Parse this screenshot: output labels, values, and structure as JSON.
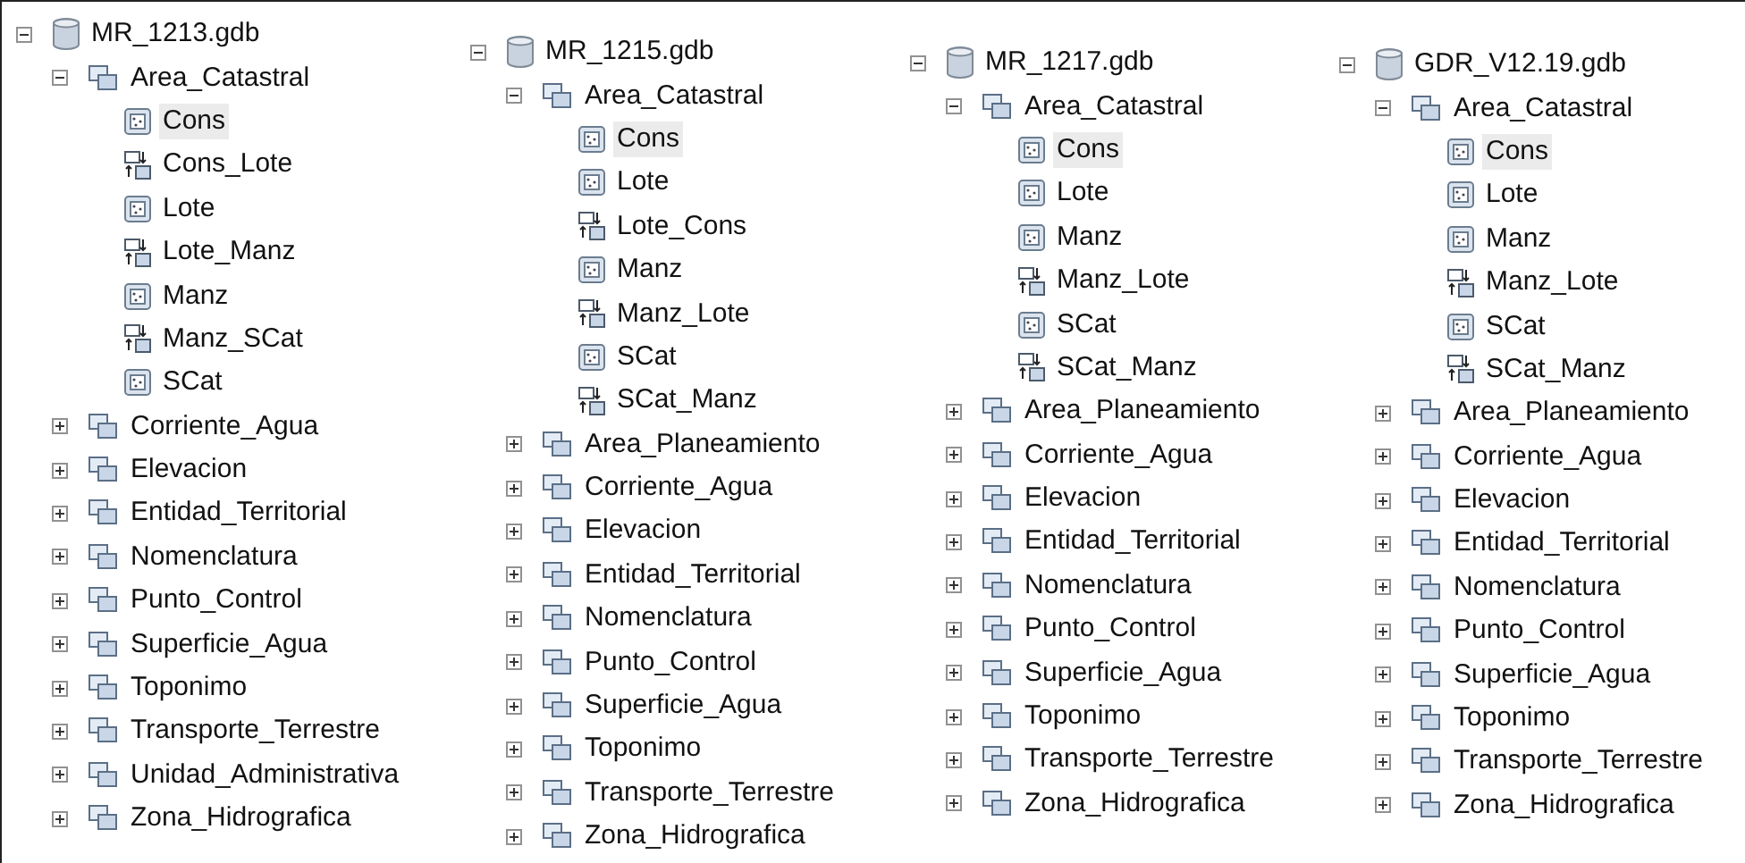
{
  "trees": [
    {
      "label": "MR_1213.gdb",
      "kind": "geodatabase",
      "expanded": true,
      "selected": false,
      "children": [
        {
          "label": "Area_Catastral",
          "kind": "feature_dataset",
          "expanded": true,
          "selected": false,
          "children": [
            {
              "label": "Cons",
              "kind": "feature_class",
              "selected": true
            },
            {
              "label": "Cons_Lote",
              "kind": "relationship",
              "selected": false
            },
            {
              "label": "Lote",
              "kind": "feature_class",
              "selected": false
            },
            {
              "label": "Lote_Manz",
              "kind": "relationship",
              "selected": false
            },
            {
              "label": "Manz",
              "kind": "feature_class",
              "selected": false
            },
            {
              "label": "Manz_SCat",
              "kind": "relationship",
              "selected": false
            },
            {
              "label": "SCat",
              "kind": "feature_class",
              "selected": false
            }
          ]
        },
        {
          "label": "Corriente_Agua",
          "kind": "feature_dataset",
          "expanded": false,
          "selected": false
        },
        {
          "label": "Elevacion",
          "kind": "feature_dataset",
          "expanded": false,
          "selected": false
        },
        {
          "label": "Entidad_Territorial",
          "kind": "feature_dataset",
          "expanded": false,
          "selected": false
        },
        {
          "label": "Nomenclatura",
          "kind": "feature_dataset",
          "expanded": false,
          "selected": false
        },
        {
          "label": "Punto_Control",
          "kind": "feature_dataset",
          "expanded": false,
          "selected": false
        },
        {
          "label": "Superficie_Agua",
          "kind": "feature_dataset",
          "expanded": false,
          "selected": false
        },
        {
          "label": "Toponimo",
          "kind": "feature_dataset",
          "expanded": false,
          "selected": false
        },
        {
          "label": "Transporte_Terrestre",
          "kind": "feature_dataset",
          "expanded": false,
          "selected": false
        },
        {
          "label": "Unidad_Administrativa",
          "kind": "feature_dataset",
          "expanded": false,
          "selected": false
        },
        {
          "label": "Zona_Hidrografica",
          "kind": "feature_dataset",
          "expanded": false,
          "selected": false
        }
      ]
    },
    {
      "label": "MR_1215.gdb",
      "kind": "geodatabase",
      "expanded": true,
      "selected": false,
      "children": [
        {
          "label": "Area_Catastral",
          "kind": "feature_dataset",
          "expanded": true,
          "selected": false,
          "children": [
            {
              "label": "Cons",
              "kind": "feature_class",
              "selected": true
            },
            {
              "label": "Lote",
              "kind": "feature_class",
              "selected": false
            },
            {
              "label": "Lote_Cons",
              "kind": "relationship",
              "selected": false
            },
            {
              "label": "Manz",
              "kind": "feature_class",
              "selected": false
            },
            {
              "label": "Manz_Lote",
              "kind": "relationship",
              "selected": false
            },
            {
              "label": "SCat",
              "kind": "feature_class",
              "selected": false
            },
            {
              "label": "SCat_Manz",
              "kind": "relationship",
              "selected": false
            }
          ]
        },
        {
          "label": "Area_Planeamiento",
          "kind": "feature_dataset",
          "expanded": false,
          "selected": false
        },
        {
          "label": "Corriente_Agua",
          "kind": "feature_dataset",
          "expanded": false,
          "selected": false
        },
        {
          "label": "Elevacion",
          "kind": "feature_dataset",
          "expanded": false,
          "selected": false
        },
        {
          "label": "Entidad_Territorial",
          "kind": "feature_dataset",
          "expanded": false,
          "selected": false
        },
        {
          "label": "Nomenclatura",
          "kind": "feature_dataset",
          "expanded": false,
          "selected": false
        },
        {
          "label": "Punto_Control",
          "kind": "feature_dataset",
          "expanded": false,
          "selected": false
        },
        {
          "label": "Superficie_Agua",
          "kind": "feature_dataset",
          "expanded": false,
          "selected": false
        },
        {
          "label": "Toponimo",
          "kind": "feature_dataset",
          "expanded": false,
          "selected": false
        },
        {
          "label": "Transporte_Terrestre",
          "kind": "feature_dataset",
          "expanded": false,
          "selected": false
        },
        {
          "label": "Zona_Hidrografica",
          "kind": "feature_dataset",
          "expanded": false,
          "selected": false
        }
      ]
    },
    {
      "label": "MR_1217.gdb",
      "kind": "geodatabase",
      "expanded": true,
      "selected": false,
      "children": [
        {
          "label": "Area_Catastral",
          "kind": "feature_dataset",
          "expanded": true,
          "selected": false,
          "children": [
            {
              "label": "Cons",
              "kind": "feature_class",
              "selected": true
            },
            {
              "label": "Lote",
              "kind": "feature_class",
              "selected": false
            },
            {
              "label": "Manz",
              "kind": "feature_class",
              "selected": false
            },
            {
              "label": "Manz_Lote",
              "kind": "relationship",
              "selected": false
            },
            {
              "label": "SCat",
              "kind": "feature_class",
              "selected": false
            },
            {
              "label": "SCat_Manz",
              "kind": "relationship",
              "selected": false
            }
          ]
        },
        {
          "label": "Area_Planeamiento",
          "kind": "feature_dataset",
          "expanded": false,
          "selected": false
        },
        {
          "label": "Corriente_Agua",
          "kind": "feature_dataset",
          "expanded": false,
          "selected": false
        },
        {
          "label": "Elevacion",
          "kind": "feature_dataset",
          "expanded": false,
          "selected": false
        },
        {
          "label": "Entidad_Territorial",
          "kind": "feature_dataset",
          "expanded": false,
          "selected": false
        },
        {
          "label": "Nomenclatura",
          "kind": "feature_dataset",
          "expanded": false,
          "selected": false
        },
        {
          "label": "Punto_Control",
          "kind": "feature_dataset",
          "expanded": false,
          "selected": false
        },
        {
          "label": "Superficie_Agua",
          "kind": "feature_dataset",
          "expanded": false,
          "selected": false
        },
        {
          "label": "Toponimo",
          "kind": "feature_dataset",
          "expanded": false,
          "selected": false
        },
        {
          "label": "Transporte_Terrestre",
          "kind": "feature_dataset",
          "expanded": false,
          "selected": false
        },
        {
          "label": "Zona_Hidrografica",
          "kind": "feature_dataset",
          "expanded": false,
          "selected": false
        }
      ]
    },
    {
      "label": "GDR_V12.19.gdb",
      "kind": "geodatabase",
      "expanded": true,
      "selected": false,
      "children": [
        {
          "label": "Area_Catastral",
          "kind": "feature_dataset",
          "expanded": true,
          "selected": false,
          "children": [
            {
              "label": "Cons",
              "kind": "feature_class",
              "selected": true
            },
            {
              "label": "Lote",
              "kind": "feature_class",
              "selected": false
            },
            {
              "label": "Manz",
              "kind": "feature_class",
              "selected": false
            },
            {
              "label": "Manz_Lote",
              "kind": "relationship",
              "selected": false
            },
            {
              "label": "SCat",
              "kind": "feature_class",
              "selected": false
            },
            {
              "label": "SCat_Manz",
              "kind": "relationship",
              "selected": false
            }
          ]
        },
        {
          "label": "Area_Planeamiento",
          "kind": "feature_dataset",
          "expanded": false,
          "selected": false
        },
        {
          "label": "Corriente_Agua",
          "kind": "feature_dataset",
          "expanded": false,
          "selected": false
        },
        {
          "label": "Elevacion",
          "kind": "feature_dataset",
          "expanded": false,
          "selected": false
        },
        {
          "label": "Entidad_Territorial",
          "kind": "feature_dataset",
          "expanded": false,
          "selected": false
        },
        {
          "label": "Nomenclatura",
          "kind": "feature_dataset",
          "expanded": false,
          "selected": false
        },
        {
          "label": "Punto_Control",
          "kind": "feature_dataset",
          "expanded": false,
          "selected": false
        },
        {
          "label": "Superficie_Agua",
          "kind": "feature_dataset",
          "expanded": false,
          "selected": false
        },
        {
          "label": "Toponimo",
          "kind": "feature_dataset",
          "expanded": false,
          "selected": false
        },
        {
          "label": "Transporte_Terrestre",
          "kind": "feature_dataset",
          "expanded": false,
          "selected": false
        },
        {
          "label": "Zona_Hidrografica",
          "kind": "feature_dataset",
          "expanded": false,
          "selected": false
        }
      ]
    }
  ]
}
